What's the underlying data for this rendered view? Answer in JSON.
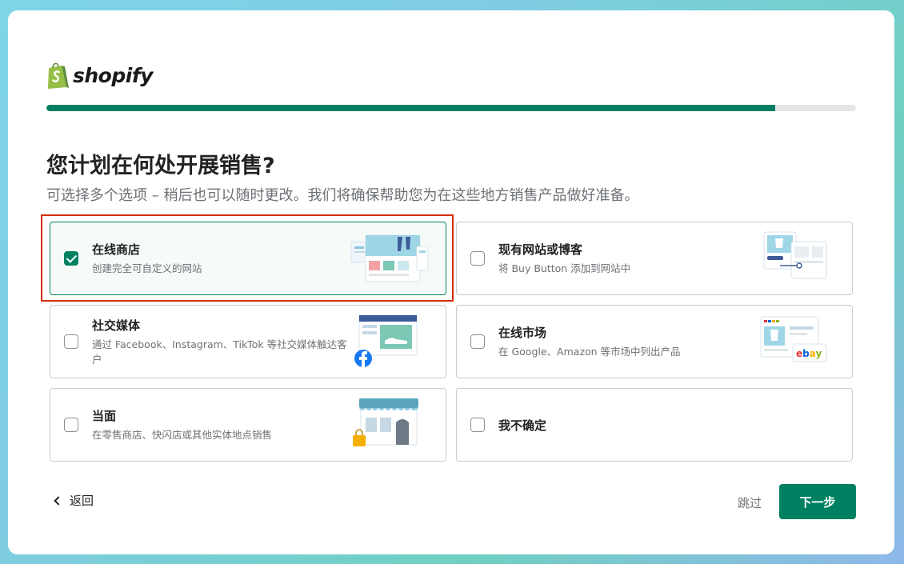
{
  "brand": {
    "name": "shopify"
  },
  "progress": {
    "fraction": 0.9
  },
  "page": {
    "title": "您计划在何处开展销售?",
    "subtitle": "可选择多个选项 – 稍后也可以随时更改。我们将确保帮助您为在这些地方销售产品做好准备。"
  },
  "options": [
    {
      "title": "在线商店",
      "desc": "创建完全可自定义的网站",
      "checked": true,
      "icon": "online-store-illustration"
    },
    {
      "title": "现有网站或博客",
      "desc": "将 Buy Button 添加到网站中",
      "checked": false,
      "icon": "website-blog-illustration"
    },
    {
      "title": "社交媒体",
      "desc": "通过 Facebook、Instagram、TikTok 等社交媒体触达客户",
      "checked": false,
      "icon": "social-media-illustration"
    },
    {
      "title": "在线市场",
      "desc": "在 Google、Amazon 等市场中列出产品",
      "checked": false,
      "icon": "marketplace-illustration",
      "badge": "ebay"
    },
    {
      "title": "当面",
      "desc": "在零售商店、快闪店或其他实体地点销售",
      "checked": false,
      "icon": "in-person-store-illustration"
    },
    {
      "title": "我不确定",
      "desc": "",
      "checked": false,
      "icon": ""
    }
  ],
  "footer": {
    "back": "返回",
    "skip": "跳过",
    "next": "下一步"
  },
  "colors": {
    "primary": "#008060",
    "highlight": "#d72c0d",
    "brand_green": "#95bf47"
  }
}
